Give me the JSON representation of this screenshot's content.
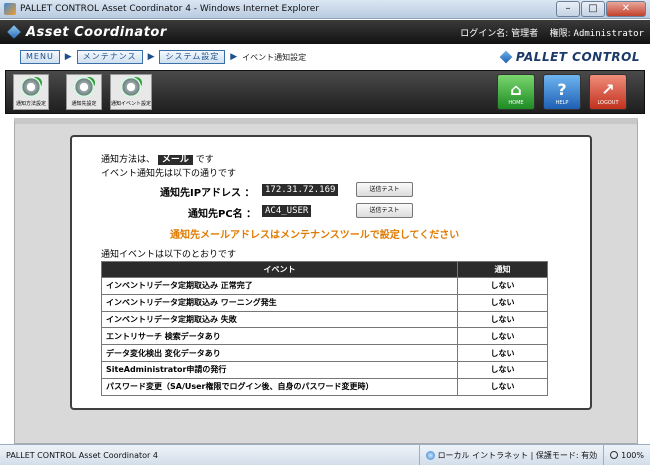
{
  "window": {
    "title": "PALLET CONTROL Asset Coordinator 4 - Windows Internet Explorer",
    "minimize": "–",
    "maximize": "□",
    "close": "✕"
  },
  "header": {
    "app_name": "Asset Coordinator",
    "login_label": "ログイン名: 管理者",
    "authority_label": "権限:",
    "authority_value": "Administrator"
  },
  "breadcrumb": {
    "menu": "MENU",
    "maintenance": "メンテナンス",
    "system_settings": "システム設定",
    "current": "イベント通知設定",
    "separator": "▶"
  },
  "brand": "PALLET CONTROL",
  "toolbar": {
    "left_tools": [
      {
        "label": "通知方法設定"
      },
      {
        "label": "通知先設定"
      },
      {
        "label": "通知イベント設定"
      }
    ],
    "home": {
      "label": "HOME",
      "glyph": "⌂"
    },
    "help": {
      "label": "HELP",
      "glyph": "?"
    },
    "logout": {
      "label": "LOGOUT",
      "glyph": "↗"
    }
  },
  "content": {
    "method_prefix": "通知方法は、",
    "method_value": "メール",
    "method_suffix": "です",
    "dest_intro": "イベント通知先は以下の通りです",
    "ip_label": "通知先IPアドレス ：",
    "ip_value": "172.31.72.169",
    "pc_label": "通知先PC名 ：",
    "pc_value": "AC4_USER",
    "send_test": "送信テスト",
    "mail_notice": "通知先メールアドレスはメンテナンスツールで設定してください",
    "events_intro": "通知イベントは以下のとおりです"
  },
  "events_table": {
    "headers": [
      "イベント",
      "通知"
    ],
    "rows": [
      {
        "event": "インベントリデータ定期取込み 正常完了",
        "notify": "しない"
      },
      {
        "event": "インベントリデータ定期取込み ワーニング発生",
        "notify": "しない"
      },
      {
        "event": "インベントリデータ定期取込み 失敗",
        "notify": "しない"
      },
      {
        "event": "エントリサーチ 検索データあり",
        "notify": "しない"
      },
      {
        "event": "データ変化検出 変化データあり",
        "notify": "しない"
      },
      {
        "event": "SiteAdministrator申請の発行",
        "notify": "しない"
      },
      {
        "event": "パスワード変更（SA/User権限でログイン後、自身のパスワード変更時）",
        "notify": "しない"
      }
    ]
  },
  "statusbar": {
    "title": "PALLET CONTROL Asset Coordinator 4",
    "zone": "ローカル イントラネット | 保護モード: 有効",
    "zoom": "100%"
  }
}
